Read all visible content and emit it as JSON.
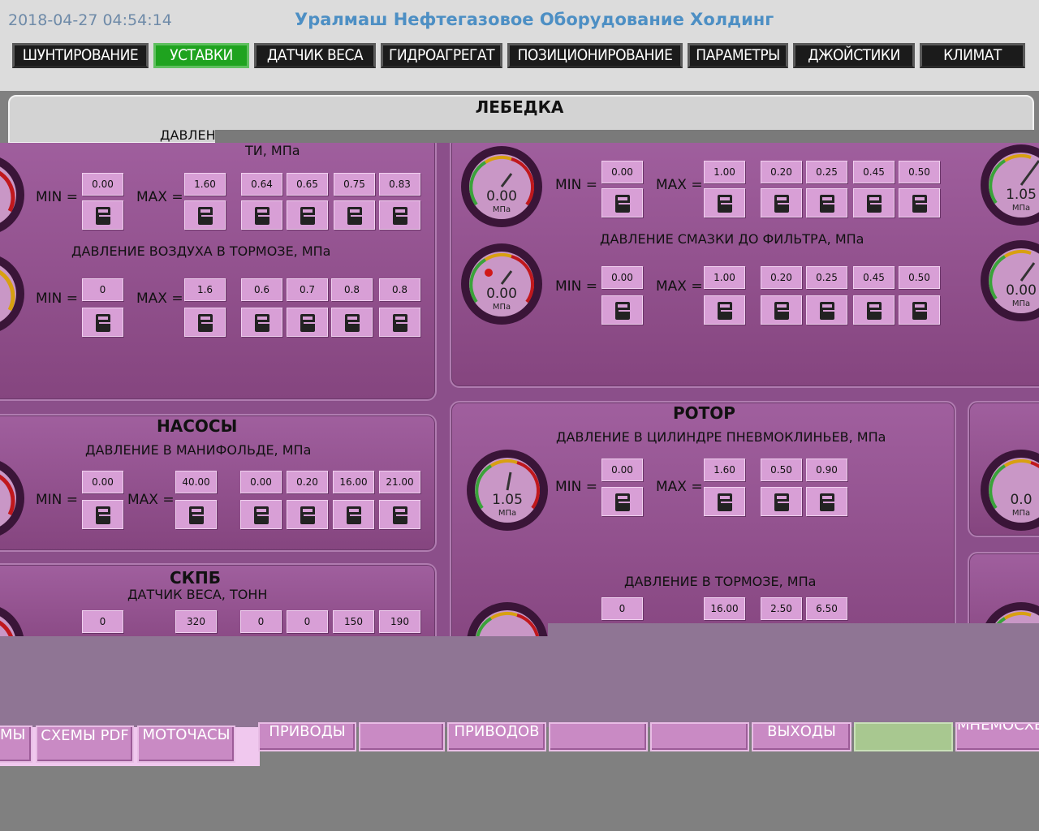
{
  "header": {
    "datetime": "2018-04-27 04:54:14",
    "company": "Уралмаш Нефтегазовое Оборудование Холдинг"
  },
  "nav": [
    {
      "label": "ШУНТИРОВАНИЕ",
      "active": false
    },
    {
      "label": "УСТАВКИ",
      "active": true
    },
    {
      "label": "ДАТЧИК ВЕСА",
      "active": false
    },
    {
      "label": "ГИДРОАГРЕГАТ",
      "active": false
    },
    {
      "label": "ПОЗИЦИОНИРОВАНИЕ",
      "active": false
    },
    {
      "label": "ПАРАМЕТРЫ",
      "active": false
    },
    {
      "label": "ДЖОЙСТИКИ",
      "active": false
    },
    {
      "label": "КЛИМАТ",
      "active": false
    }
  ],
  "lebedka": {
    "title": "ЛЕБЕДКА",
    "clipped_label": "ДАВЛЕН",
    "left_top_label_tail": "ТИ, МПа",
    "row1": {
      "min": "0.00",
      "max": "1.60",
      "thresholds": [
        "0.64",
        "0.65",
        "0.75",
        "0.83"
      ]
    },
    "row2": {
      "label": "ДАВЛЕНИЕ ВОЗДУХА В ТОРМОЗЕ, МПа",
      "min": "0",
      "max": "1.6",
      "thresholds": [
        "0.6",
        "0.7",
        "0.8",
        "0.8"
      ]
    },
    "right_row1": {
      "gauge": "0.00",
      "min": "0.00",
      "max": "1.00",
      "thresholds": [
        "0.20",
        "0.25",
        "0.45",
        "0.50"
      ]
    },
    "right_row2": {
      "label": "ДАВЛЕНИЕ СМАЗКИ ДО ФИЛЬТРА, МПа",
      "gauge": "0.00",
      "min": "0.00",
      "max": "1.00",
      "thresholds": [
        "0.20",
        "0.25",
        "0.45",
        "0.50"
      ]
    },
    "far_right_gauges": [
      "1.05",
      "0.00"
    ]
  },
  "labels": {
    "min": "MIN =",
    "max": "MAX =",
    "unit": "МПа"
  },
  "nasosy": {
    "title": "НАСОСЫ",
    "label": "ДАВЛЕНИЕ В МАНИФОЛЬДЕ, МПа",
    "min": "0.00",
    "max": "40.00",
    "thresholds": [
      "0.00",
      "0.20",
      "16.00",
      "21.00"
    ]
  },
  "skpb": {
    "title": "СКПБ",
    "label": "ДАТЧИК ВЕСА, ТОНН",
    "min": "0",
    "max": "320",
    "thresholds": [
      "0",
      "0",
      "150",
      "190"
    ]
  },
  "rotor": {
    "title": "РОТОР",
    "label1": "ДАВЛЕНИЕ В ЦИЛИНДРЕ ПНЕВМОКЛИНЬЕВ, МПа",
    "gauge1": "1.05",
    "min1": "0.00",
    "max1": "1.60",
    "thresholds1": [
      "0.50",
      "0.90"
    ],
    "label2": "ДАВЛЕНИЕ В ТОРМОЗЕ, МПа",
    "min2": "0",
    "max2": "16.00",
    "thresholds2": [
      "2.50",
      "6.50"
    ],
    "right_gauge": "0.0"
  },
  "bottom": [
    {
      "label": "ЕМЫ"
    },
    {
      "label": "СХЕМЫ PDF"
    },
    {
      "label": "МОТОЧАСЫ"
    },
    {
      "label": "ПРИВОДЫ"
    },
    {
      "label": ""
    },
    {
      "label": "ПРИВОДОВ"
    },
    {
      "label": ""
    },
    {
      "label": ""
    },
    {
      "label": "ВЫХОДЫ"
    },
    {
      "label": ""
    },
    {
      "label": "МНЕМОСХЕ"
    }
  ]
}
